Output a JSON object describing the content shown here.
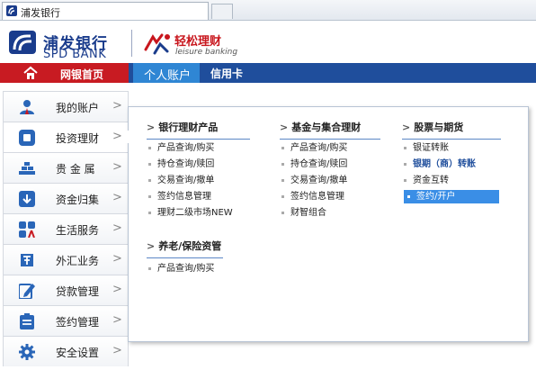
{
  "browser": {
    "tab_title": "浦发银行"
  },
  "brand": {
    "name_cn": "浦发银行",
    "name_en": "SPD BANK",
    "sub_brand_cn": "轻松理财",
    "sub_brand_en": "leisure banking",
    "primary_color": "#1a3c8c",
    "accent_red": "#c81b22"
  },
  "nav": {
    "home_label": "网银首页",
    "personal_label": "个人账户",
    "card_label": "信用卡"
  },
  "sidebar": {
    "arrow": ">",
    "items": [
      {
        "label": "我的账户",
        "icon": "user-icon"
      },
      {
        "label": "投资理财",
        "icon": "investment-icon"
      },
      {
        "label": "贵 金 属",
        "icon": "gold-bars-icon"
      },
      {
        "label": "资金归集",
        "icon": "fund-collection-icon"
      },
      {
        "label": "生活服务",
        "icon": "life-services-icon"
      },
      {
        "label": "外汇业务",
        "icon": "forex-icon"
      },
      {
        "label": "贷款管理",
        "icon": "loan-edit-icon"
      },
      {
        "label": "签约管理",
        "icon": "contract-icon"
      },
      {
        "label": "安全设置",
        "icon": "gear-icon"
      }
    ]
  },
  "menu": {
    "caret": ">",
    "columns": [
      {
        "title": "银行理财产品",
        "items": [
          "产品查询/购买",
          "持仓查询/赎回",
          "交易查询/撤单",
          "签约信息管理",
          "理财二级市场NEW"
        ]
      },
      {
        "title": "基金与集合理财",
        "items": [
          "产品查询/购买",
          "持仓查询/赎回",
          "交易查询/撤单",
          "签约信息管理",
          "财智组合"
        ]
      },
      {
        "title": "股票与期货",
        "items": [
          "银证转账",
          "银期（商）转账",
          "资金互转",
          "签约/开户"
        ]
      },
      {
        "title": "养老/保险资管",
        "items": [
          "产品查询/购买"
        ]
      }
    ]
  }
}
